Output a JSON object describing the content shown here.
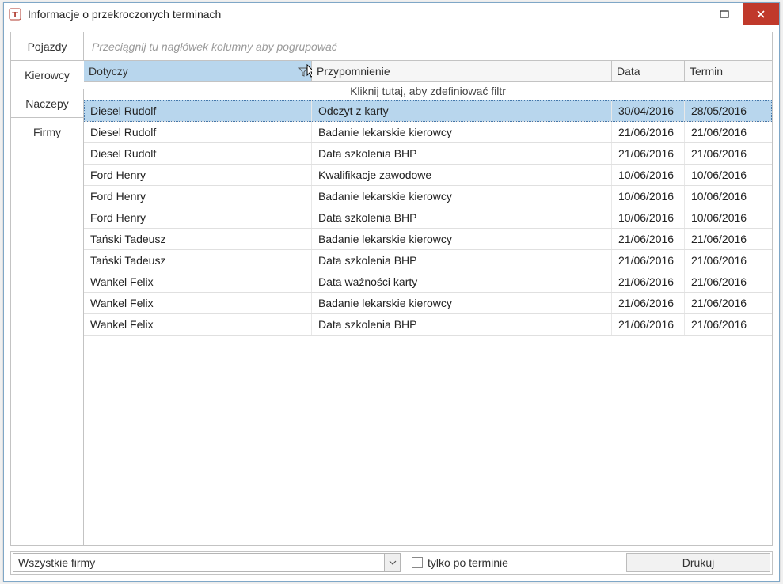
{
  "window": {
    "title": "Informacje o przekroczonych terminach"
  },
  "tabs": {
    "items": [
      {
        "label": "Pojazdy"
      },
      {
        "label": "Kierowcy"
      },
      {
        "label": "Naczepy"
      },
      {
        "label": "Firmy"
      }
    ],
    "activeIndex": 1
  },
  "grid": {
    "groupHint": "Przeciągnij tu nagłówek kolumny aby pogrupować",
    "filterHint": "Kliknij tutaj, aby zdefiniować filtr",
    "columns": {
      "dotyczy": "Dotyczy",
      "przypomnienie": "Przypomnienie",
      "data": "Data",
      "termin": "Termin"
    },
    "rows": [
      {
        "dotyczy": "Diesel Rudolf",
        "przypomnienie": "Odczyt z karty",
        "data": "30/04/2016",
        "termin": "28/05/2016",
        "selected": true
      },
      {
        "dotyczy": "Diesel Rudolf",
        "przypomnienie": "Badanie lekarskie kierowcy",
        "data": "21/06/2016",
        "termin": "21/06/2016"
      },
      {
        "dotyczy": "Diesel Rudolf",
        "przypomnienie": "Data szkolenia BHP",
        "data": "21/06/2016",
        "termin": "21/06/2016"
      },
      {
        "dotyczy": "Ford Henry",
        "przypomnienie": "Kwalifikacje zawodowe",
        "data": "10/06/2016",
        "termin": "10/06/2016"
      },
      {
        "dotyczy": "Ford Henry",
        "przypomnienie": "Badanie lekarskie kierowcy",
        "data": "10/06/2016",
        "termin": "10/06/2016"
      },
      {
        "dotyczy": "Ford Henry",
        "przypomnienie": "Data szkolenia BHP",
        "data": "10/06/2016",
        "termin": "10/06/2016"
      },
      {
        "dotyczy": "Tański Tadeusz",
        "przypomnienie": "Badanie lekarskie kierowcy",
        "data": "21/06/2016",
        "termin": "21/06/2016"
      },
      {
        "dotyczy": "Tański Tadeusz",
        "przypomnienie": "Data szkolenia BHP",
        "data": "21/06/2016",
        "termin": "21/06/2016"
      },
      {
        "dotyczy": "Wankel Felix",
        "przypomnienie": "Data ważności karty",
        "data": "21/06/2016",
        "termin": "21/06/2016"
      },
      {
        "dotyczy": "Wankel Felix",
        "przypomnienie": "Badanie lekarskie kierowcy",
        "data": "21/06/2016",
        "termin": "21/06/2016"
      },
      {
        "dotyczy": "Wankel Felix",
        "przypomnienie": "Data szkolenia BHP",
        "data": "21/06/2016",
        "termin": "21/06/2016"
      }
    ]
  },
  "bottom": {
    "firmSelect": "Wszystkie firmy",
    "checkboxLabel": "tylko po terminie",
    "printLabel": "Drukuj"
  }
}
